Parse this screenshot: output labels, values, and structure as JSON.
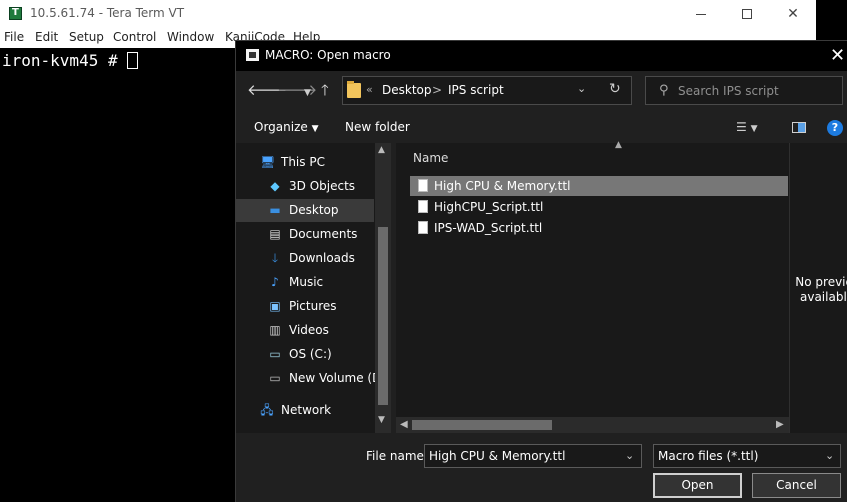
{
  "terminal_window": {
    "title": "10.5.61.74 - Tera Term VT",
    "menu": [
      "File",
      "Edit",
      "Setup",
      "Control",
      "Window",
      "KanjiCode",
      "Help"
    ],
    "prompt": "iron-kvm45 # "
  },
  "dialog": {
    "title": "MACRO: Open macro",
    "close_glyph": "✕",
    "address": {
      "chevrons": "«",
      "segments": [
        "Desktop",
        "IPS script"
      ],
      "separator": ">"
    },
    "search": {
      "placeholder": "Search IPS script"
    },
    "toolbar": {
      "organize_label": "Organize",
      "new_folder_label": "New folder",
      "help_glyph": "?"
    },
    "nav_tree": [
      {
        "label": "This PC",
        "icon": "computer-icon"
      },
      {
        "label": "3D Objects",
        "icon": "3d-objects-icon"
      },
      {
        "label": "Desktop",
        "icon": "desktop-icon",
        "selected": true
      },
      {
        "label": "Documents",
        "icon": "documents-icon"
      },
      {
        "label": "Downloads",
        "icon": "downloads-icon"
      },
      {
        "label": "Music",
        "icon": "music-icon"
      },
      {
        "label": "Pictures",
        "icon": "pictures-icon"
      },
      {
        "label": "Videos",
        "icon": "videos-icon"
      },
      {
        "label": "OS (C:)",
        "icon": "drive-icon"
      },
      {
        "label": "New Volume (D:",
        "icon": "drive-icon"
      },
      {
        "label": "Network",
        "icon": "network-icon"
      }
    ],
    "file_list": {
      "column_name": "Name",
      "files": [
        {
          "name": "High CPU & Memory.ttl",
          "selected": true
        },
        {
          "name": "HighCPU_Script.ttl"
        },
        {
          "name": "IPS-WAD_Script.ttl"
        }
      ]
    },
    "preview": {
      "text_line1": "No preview",
      "text_line2": "available."
    },
    "file_name_label": "File name:",
    "file_name_value": "High CPU & Memory.ttl",
    "file_type_value": "Macro files (*.ttl)",
    "open_label": "Open",
    "cancel_label": "Cancel"
  },
  "colors": {
    "dialog_bg": "#202020",
    "pane_bg": "#191919",
    "selection": "#777777",
    "accent": "#1d7be0"
  }
}
